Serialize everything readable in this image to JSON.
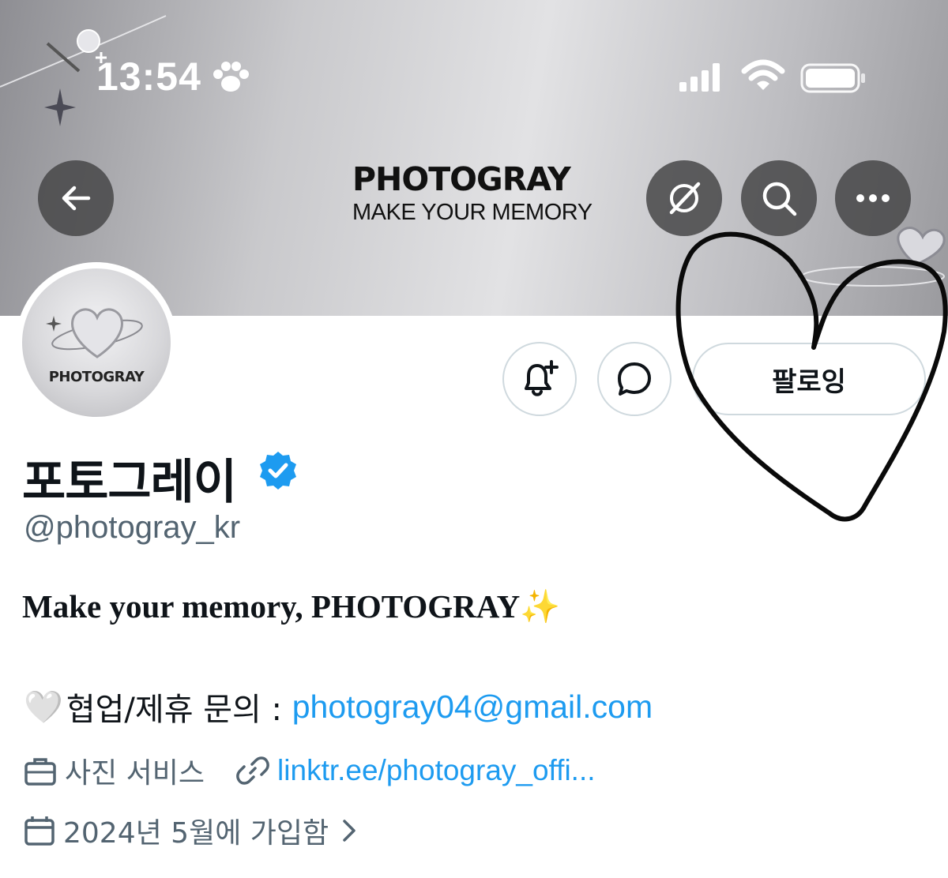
{
  "status_bar": {
    "time": "13:54",
    "icons": [
      "paw-icon",
      "cellular-signal-icon",
      "wifi-icon",
      "battery-icon"
    ]
  },
  "header": {
    "brand_name": "PHOTOGRAY",
    "brand_tagline": "MAKE YOUR MEMORY",
    "buttons": [
      "back-arrow-icon",
      "grok-icon",
      "search-icon",
      "more-icon"
    ]
  },
  "profile": {
    "avatar_text": "PHOTOGRAY",
    "display_name": "포토그레이",
    "handle": "@photogray_kr",
    "follow_label": "팔로잉",
    "bio_line1": "Make your memory, PHOTOGRAY",
    "bio_sparkle": "✨",
    "bio_heart": "🤍",
    "bio_contact_label": "협업/제휴 문의 : ",
    "bio_email": "photogray04@gmail.com",
    "category": "사진 서비스",
    "website": "linktr.ee/photogray_offi...",
    "joined": "2024년 5월에 가입함"
  },
  "colors": {
    "accent": "#1d9bf0",
    "secondary_text": "#536471",
    "verified": "#1d9bf0",
    "border": "#cfd9de"
  }
}
